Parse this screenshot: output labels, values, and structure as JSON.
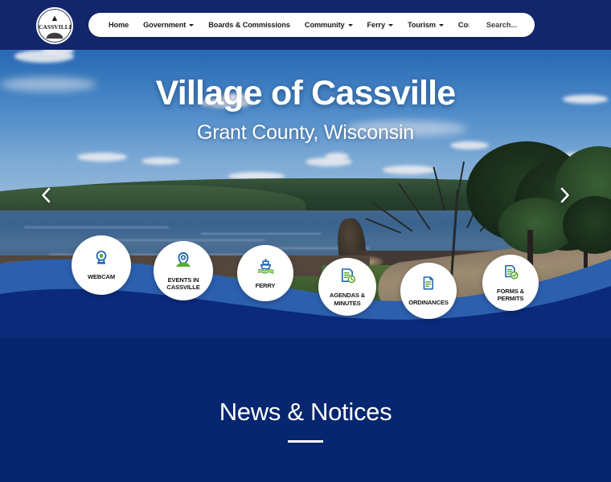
{
  "site": {
    "logo_text": "CASSVILLE",
    "logo_icon": "village-seal-logo"
  },
  "nav": {
    "items": [
      {
        "label": "Home",
        "has_dropdown": false,
        "icon": ""
      },
      {
        "label": "Government",
        "has_dropdown": true,
        "icon": "chevron-down-icon"
      },
      {
        "label": "Boards & Commissions",
        "has_dropdown": false,
        "icon": ""
      },
      {
        "label": "Community",
        "has_dropdown": true,
        "icon": "chevron-down-icon"
      },
      {
        "label": "Ferry",
        "has_dropdown": true,
        "icon": "chevron-down-icon"
      },
      {
        "label": "Tourism",
        "has_dropdown": true,
        "icon": "chevron-down-icon"
      },
      {
        "label": "Contact Us",
        "has_dropdown": false,
        "icon": ""
      }
    ]
  },
  "search": {
    "placeholder": "Search...",
    "icon": "search-icon"
  },
  "hero": {
    "title": "Village of Cassville",
    "subtitle": "Grant County, Wisconsin",
    "prev_icon": "chevron-left-icon",
    "next_icon": "chevron-right-icon",
    "image_description": "Riverside park along the Mississippi River with rocky shoreline, grass, trees and a walking path"
  },
  "quick_links": [
    {
      "label": "WEBCAM",
      "icon": "webcam-icon"
    },
    {
      "label": "EVENTS IN CASSVILLE",
      "icon": "map-pin-icon"
    },
    {
      "label": "FERRY",
      "icon": "ferry-boat-icon"
    },
    {
      "label": "AGENDAS & MINUTES",
      "icon": "document-clock-icon"
    },
    {
      "label": "ORDINANCES",
      "icon": "document-icon"
    },
    {
      "label": "FORMS & PERMITS",
      "icon": "document-check-icon"
    }
  ],
  "news": {
    "heading": "News & Notices"
  },
  "colors": {
    "header_navy": "#13256b",
    "section_navy": "#06266f",
    "wave_light_blue": "#2c5fad",
    "wave_dark_navy": "#0b2a7c",
    "icon_blue": "#1b63b4",
    "icon_green": "#5aa935",
    "white": "#ffffff"
  }
}
